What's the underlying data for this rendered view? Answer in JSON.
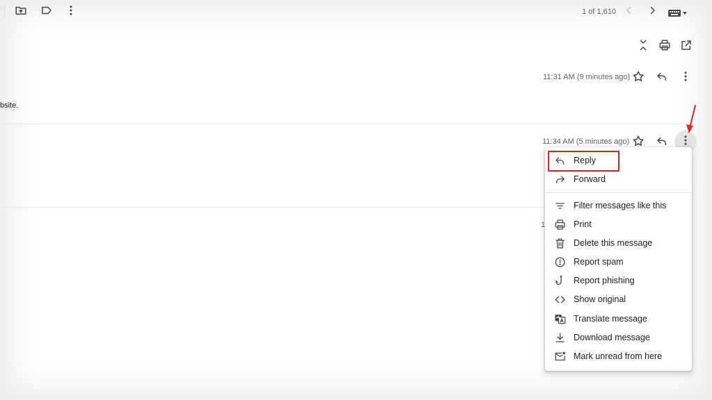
{
  "toolbar": {
    "pager": "1 of 1,610",
    "icons": [
      "move-to-folder-icon",
      "label-icon",
      "more-vert-icon",
      "chevron-left-icon",
      "chevron-right-icon",
      "keyboard-icon",
      "caret-down-icon"
    ]
  },
  "thread_actions": {
    "icons": [
      "collapse-all-icon",
      "print-icon",
      "open-in-new-window-icon"
    ]
  },
  "messages": [
    {
      "time": "11:31 AM (9 minutes ago)",
      "snippet": "bsite."
    },
    {
      "time": "11:34 AM (5 minutes ago)"
    },
    {
      "time_partial": "1"
    }
  ],
  "context_menu": {
    "items": [
      {
        "label": "Reply",
        "icon": "reply-icon"
      },
      {
        "label": "Forward",
        "icon": "forward-icon"
      },
      {
        "label": "Filter messages like this",
        "icon": "filter-icon"
      },
      {
        "label": "Print",
        "icon": "print-icon"
      },
      {
        "label": "Delete this message",
        "icon": "trash-icon"
      },
      {
        "label": "Report spam",
        "icon": "report-icon"
      },
      {
        "label": "Report phishing",
        "icon": "phishing-hook-icon"
      },
      {
        "label": "Show original",
        "icon": "code-icon"
      },
      {
        "label": "Translate message",
        "icon": "translate-icon"
      },
      {
        "label": "Download message",
        "icon": "download-icon"
      },
      {
        "label": "Mark unread from here",
        "icon": "mark-unread-icon"
      }
    ]
  },
  "colors": {
    "highlight": "#e02424",
    "icon": "#444746",
    "secondary_text": "#5f6368"
  }
}
